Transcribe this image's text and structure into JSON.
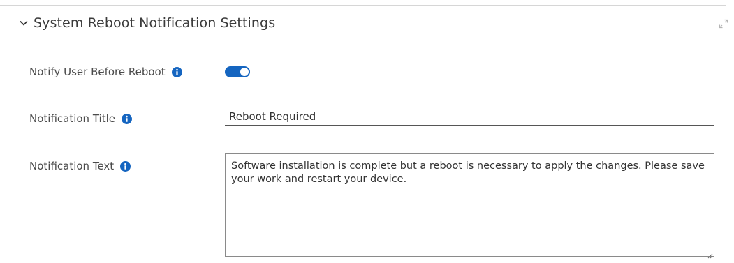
{
  "section": {
    "title": "System Reboot Notification Settings",
    "expanded": true
  },
  "notify_user": {
    "label": "Notify User Before Reboot",
    "enabled": true
  },
  "notification_title": {
    "label": "Notification Title",
    "value": "Reboot Required"
  },
  "notification_text": {
    "label": "Notification Text",
    "value": "Software installation is complete but a reboot is necessary to apply the changes. Please save your work and restart your device."
  },
  "icons": {
    "section_toggle": "chevron-down-icon",
    "expand": "expand-icon",
    "info": "info-icon"
  },
  "colors": {
    "accent": "#1565c0",
    "info_icon": "#1565c0"
  }
}
